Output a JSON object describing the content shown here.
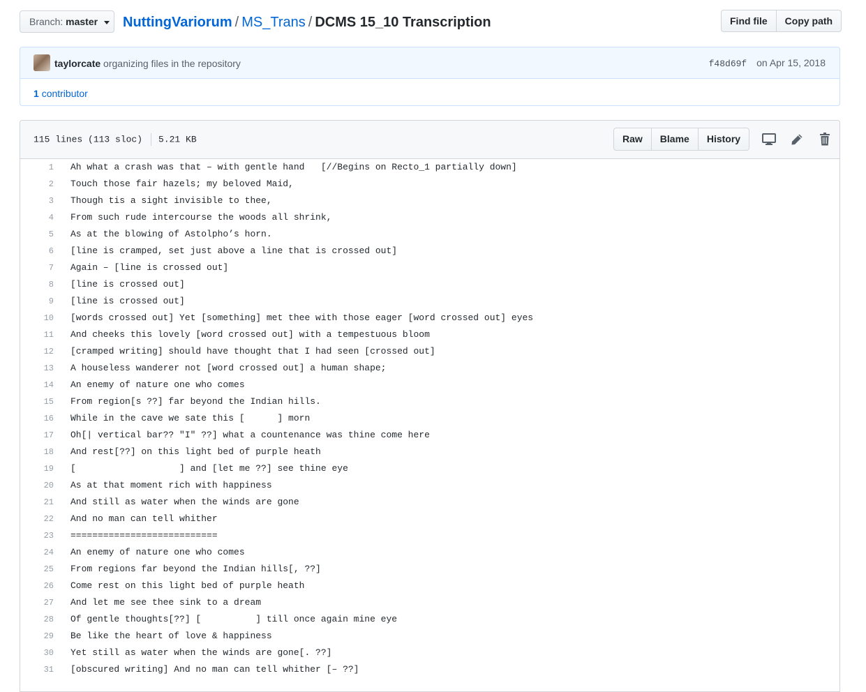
{
  "branch": {
    "prefix": "Branch:",
    "name": "master"
  },
  "breadcrumb": {
    "owner": "NuttingVariorum",
    "folder": "MS_Trans",
    "file": "DCMS 15_10 Transcription",
    "separator": "/"
  },
  "header_buttons": {
    "find_file": "Find file",
    "copy_path": "Copy path"
  },
  "commit": {
    "author": "taylorcate",
    "message": "organizing files in the repository",
    "sha": "f48d69f",
    "date": "on Apr 15, 2018"
  },
  "contributors": {
    "count": "1",
    "label": "contributor"
  },
  "file": {
    "lines_info": "115 lines (113 sloc)",
    "size": "5.21 KB",
    "buttons": {
      "raw": "Raw",
      "blame": "Blame",
      "history": "History"
    },
    "icons": [
      "desktop-icon",
      "pencil-icon",
      "trash-icon"
    ]
  },
  "code_lines": [
    "Ah what a crash was that – with gentle hand   [//Begins on Recto_1 partially down]",
    "Touch those fair hazels; my beloved Maid,",
    "Though tis a sight invisible to thee,",
    "From such rude intercourse the woods all shrink,",
    "As at the blowing of Astolpho’s horn.",
    "[line is cramped, set just above a line that is crossed out]",
    "Again – [line is crossed out]",
    "[line is crossed out]",
    "[line is crossed out]",
    "[words crossed out] Yet [something] met thee with those eager [word crossed out] eyes",
    "And cheeks this lovely [word crossed out] with a tempestuous bloom",
    "[cramped writing] should have thought that I had seen [crossed out]",
    "A houseless wanderer not [word crossed out] a human shape;",
    "An enemy of nature one who comes",
    "From region[s ??] far beyond the Indian hills.",
    "While in the cave we sate this [      ] morn",
    "Oh[| vertical bar?? \"I\" ??] what a countenance was thine come here",
    "And rest[??] on this light bed of purple heath",
    "[                   ] and [let me ??] see thine eye",
    "As at that moment rich with happiness",
    "And still as water when the winds are gone",
    "And no man can tell whither",
    "===========================",
    "An enemy of nature one who comes",
    "From regions far beyond the Indian hills[, ??]",
    "Come rest on this light bed of purple heath",
    "And let me see thee sink to a dream",
    "Of gentle thoughts[??] [          ] till once again mine eye",
    "Be like the heart of love & happiness",
    "Yet still as water when the winds are gone[. ??]",
    "[obscured writing] And no man can tell whither [– ??]"
  ]
}
